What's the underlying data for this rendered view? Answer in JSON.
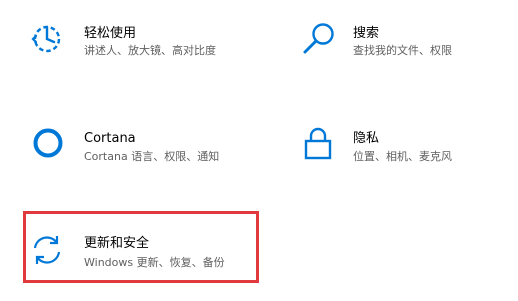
{
  "accent_color": "#0078d7",
  "highlight_color": "#e0393e",
  "tiles": [
    {
      "icon": "ease-of-access-icon",
      "title": "轻松使用",
      "desc": "讲述人、放大镜、高对比度"
    },
    {
      "icon": "search-icon",
      "title": "搜索",
      "desc": "查找我的文件、权限"
    },
    {
      "icon": "cortana-icon",
      "title": "Cortana",
      "desc": "Cortana 语言、权限、通知"
    },
    {
      "icon": "lock-icon",
      "title": "隐私",
      "desc": "位置、相机、麦克风"
    },
    {
      "icon": "sync-icon",
      "title": "更新和安全",
      "desc": "Windows 更新、恢复、备份"
    }
  ]
}
